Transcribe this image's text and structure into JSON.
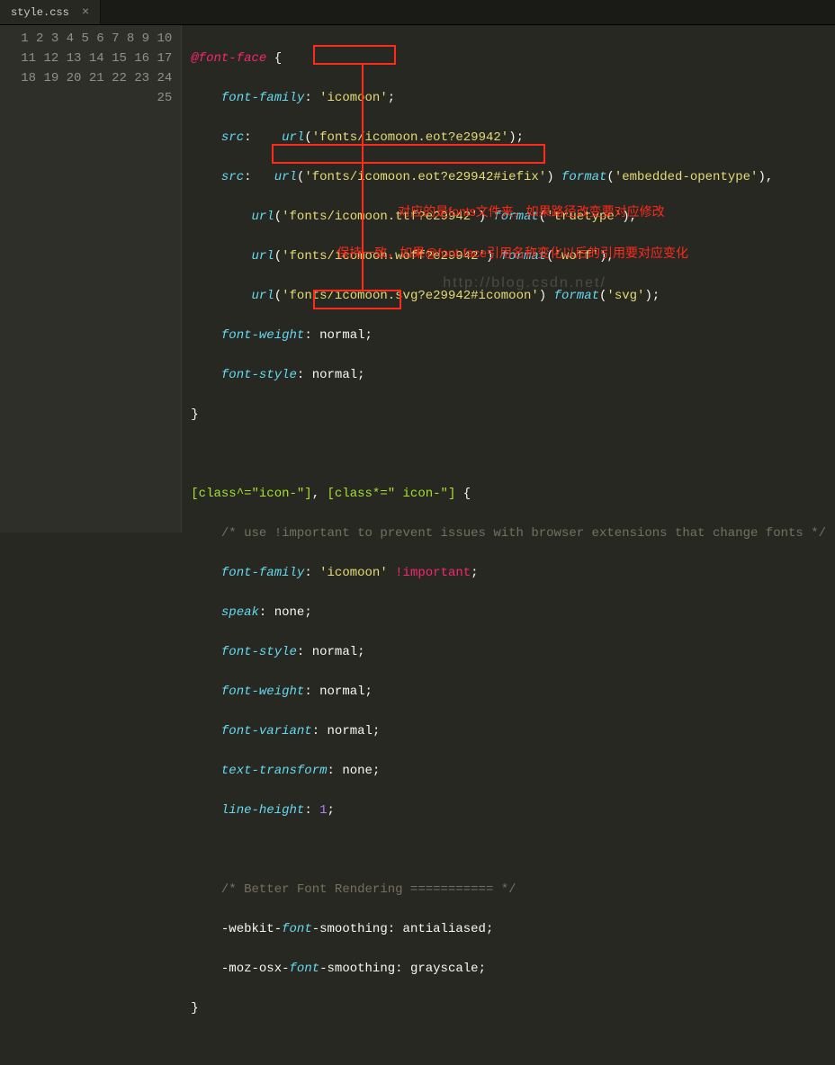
{
  "tab": {
    "filename": "style.css",
    "close": "×"
  },
  "gutter": {
    "start": 1,
    "end": 25
  },
  "code": {
    "l1": {
      "at": "@font-face",
      "brace": " {"
    },
    "l2": {
      "prop": "font-family",
      "colon": ": ",
      "val": "'icomoon'",
      "semi": ";"
    },
    "l3": {
      "prop": "src",
      "colon": ":    ",
      "fn": "url",
      "arg": "'fonts/icomoon.eot?e29942'",
      "semi": ";"
    },
    "l4": {
      "prop": "src",
      "colon": ":   ",
      "u1": "'fonts/icomoon.eot?e29942#iefix'",
      "f1": "'embedded-opentype'",
      "comma": ","
    },
    "l5": {
      "u": "'fonts/icomoon.ttf?e29942'",
      "f": "'truetype'",
      "comma": ","
    },
    "l6": {
      "u": "'fonts/icomoon.woff?e29942'",
      "f": "'woff'",
      "comma": ","
    },
    "l7": {
      "u": "'fonts/icomoon.svg?e29942#icomoon'",
      "f": "'svg'",
      "semi": ";"
    },
    "l8": {
      "prop": "font-weight",
      "val": "normal"
    },
    "l9": {
      "prop": "font-style",
      "val": "normal"
    },
    "l10": {
      "brace": "}"
    },
    "l12": {
      "s1": "[class^=\"icon-\"]",
      "s2": "[class*=\" icon-\"]",
      "brace": " {"
    },
    "l13": {
      "c": "/* use !important to prevent issues with browser extensions that change fonts */"
    },
    "l14": {
      "prop": "font-family",
      "val": "'icomoon'",
      "imp": "!important"
    },
    "l15": {
      "prop": "speak",
      "val": "none"
    },
    "l16": {
      "prop": "font-style",
      "val": "normal"
    },
    "l17": {
      "prop": "font-weight",
      "val": "normal"
    },
    "l18": {
      "prop": "font-variant",
      "val": "normal"
    },
    "l19": {
      "prop": "text-transform",
      "val": "none"
    },
    "l20": {
      "prop": "line-height",
      "val": "1"
    },
    "l22": {
      "c": "/* Better Font Rendering =========== */"
    },
    "l23": {
      "pre": "-webkit-",
      "font": "font",
      "post": "-smoothing",
      "val": "antialiased"
    },
    "l24": {
      "pre": "-moz-osx-",
      "font": "font",
      "post": "-smoothing",
      "val": "grayscale"
    },
    "l25": {
      "brace": "}"
    }
  },
  "fn": {
    "url": "url",
    "format": "format"
  },
  "annotations": {
    "note1": "对应的是fonts文件夹，如果路径改变要对应修改",
    "note2": "保持一致，如果@font-face引用名称变化以后的引用要对应变化"
  },
  "watermark": "http://blog.csdn.net/"
}
